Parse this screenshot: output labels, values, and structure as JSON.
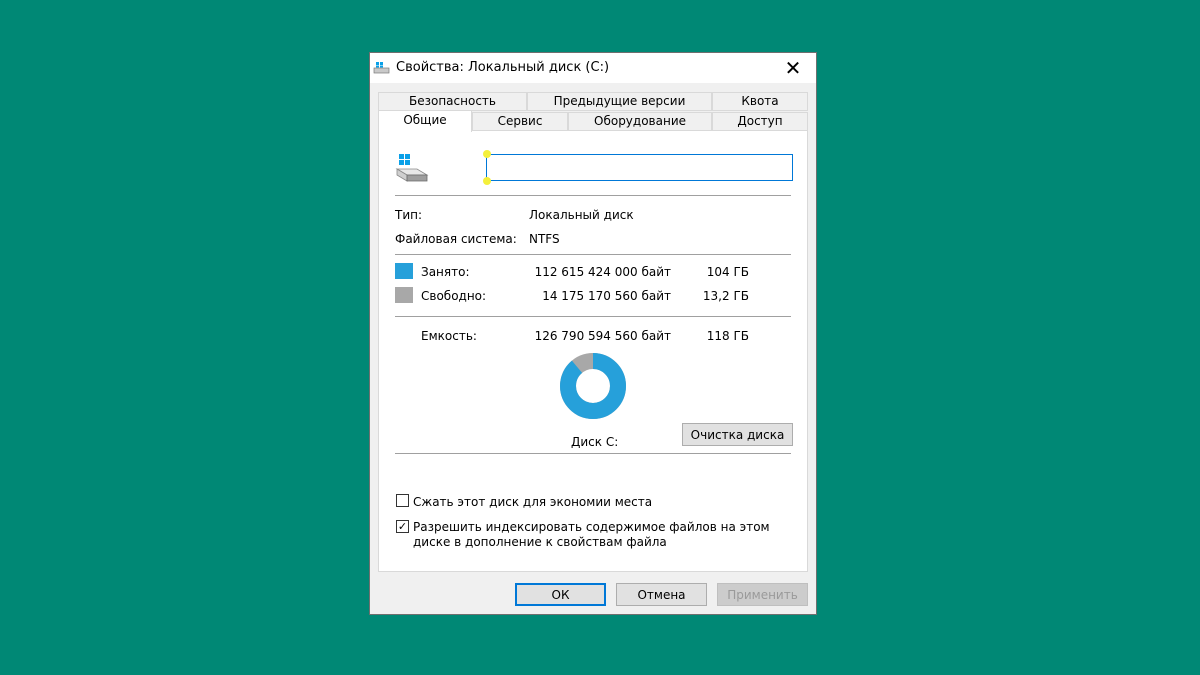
{
  "window": {
    "title": "Свойства: Локальный диск (C:)",
    "close_label": "✕"
  },
  "tabs": {
    "row1": [
      "Безопасность",
      "Предыдущие версии",
      "Квота"
    ],
    "row2": [
      "Общие",
      "Сервис",
      "Оборудование",
      "Доступ"
    ],
    "active": "Общие"
  },
  "general": {
    "drive_name_value": "",
    "type_label": "Тип:",
    "type_value": "Локальный диск",
    "fs_label": "Файловая система:",
    "fs_value": "NTFS",
    "used_label": "Занято:",
    "used_bytes": "112 615 424 000 байт",
    "used_gb": "104 ГБ",
    "free_label": "Свободно:",
    "free_bytes": "14 175 170 560 байт",
    "free_gb": "13,2 ГБ",
    "capacity_label": "Емкость:",
    "capacity_bytes": "126 790 594 560 байт",
    "capacity_gb": "118 ГБ",
    "disk_label": "Диск C:",
    "cleanup_button": "Очистка диска",
    "compress_label": "Сжать этот диск для экономии места",
    "compress_checked": false,
    "index_label_line1": "Разрешить индексировать содержимое файлов на этом",
    "index_label_line2": "диске в дополнение к свойствам файла",
    "index_checked": true,
    "used_fraction": 0.888
  },
  "colors": {
    "used": "#26a0da",
    "free": "#a8a8a8",
    "background": "#008875",
    "accent": "#0078d7"
  },
  "footer": {
    "ok": "ОК",
    "cancel": "Отмена",
    "apply": "Применить"
  }
}
